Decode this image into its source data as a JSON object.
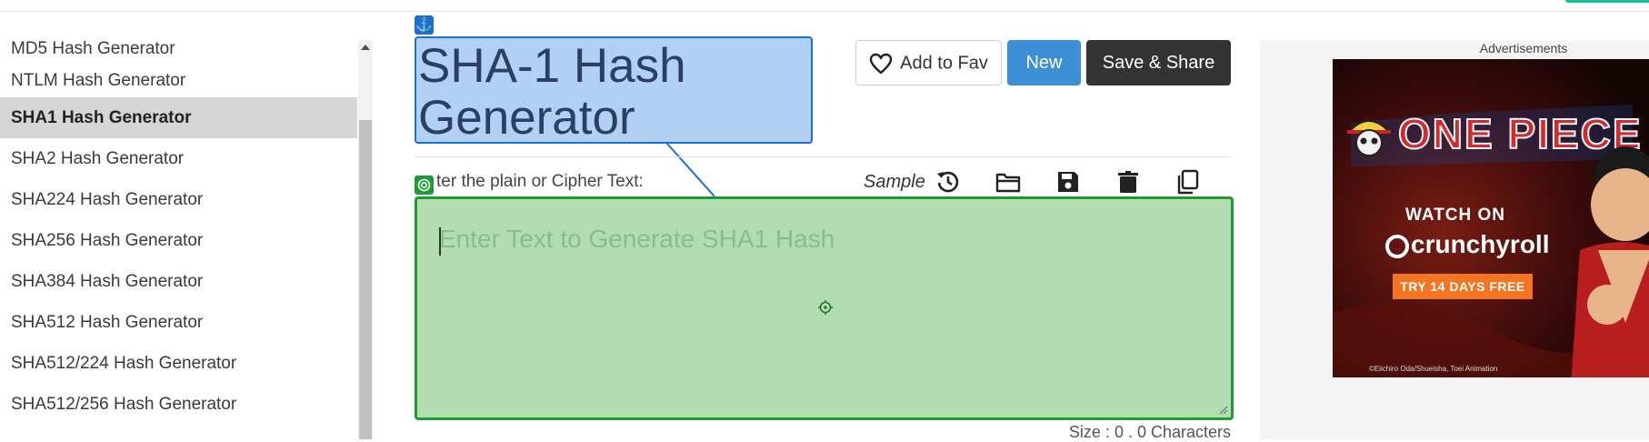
{
  "sidebar": {
    "items": [
      {
        "label": "MD5 Hash Generator"
      },
      {
        "label": "NTLM Hash Generator"
      },
      {
        "label": "SHA1 Hash Generator"
      },
      {
        "label": "SHA2 Hash Generator"
      },
      {
        "label": "SHA224 Hash Generator"
      },
      {
        "label": "SHA256 Hash Generator"
      },
      {
        "label": "SHA384 Hash Generator"
      },
      {
        "label": "SHA512 Hash Generator"
      },
      {
        "label": "SHA512/224 Hash Generator"
      },
      {
        "label": "SHA512/256 Hash Generator"
      }
    ]
  },
  "header": {
    "title": "SHA-1 Hash Generator",
    "fav_label": "Add to Fav",
    "new_label": "New",
    "save_label": "Save & Share"
  },
  "input": {
    "label": "Enter the plain or Cipher Text:",
    "label_visible": "ter the plain or Cipher Text:",
    "sample_label": "Sample",
    "placeholder": "Enter Text to Generate SHA1 Hash",
    "toolbar_icons": [
      "history-icon",
      "folder-open-icon",
      "save-icon",
      "delete-icon",
      "copy-icon"
    ]
  },
  "status": {
    "size_text": "Size : 0 . 0 Characters"
  },
  "ad": {
    "header": "Advertisements",
    "logo_text": "ONE PIECE",
    "watch_text": "WATCH ON",
    "brand": "crunchyroll",
    "cta": "TRY 14 DAYS FREE",
    "copyright": "©Eiichiro Oda/Shueisha, Toei Animation"
  },
  "colors": {
    "active_item_bg": "#d6d6d6",
    "new_button": "#3d8fd6",
    "save_button": "#333333",
    "title_overlay": "#1a6fd1",
    "input_overlay": "#1e9b32",
    "ad_cta": "#f47521"
  }
}
